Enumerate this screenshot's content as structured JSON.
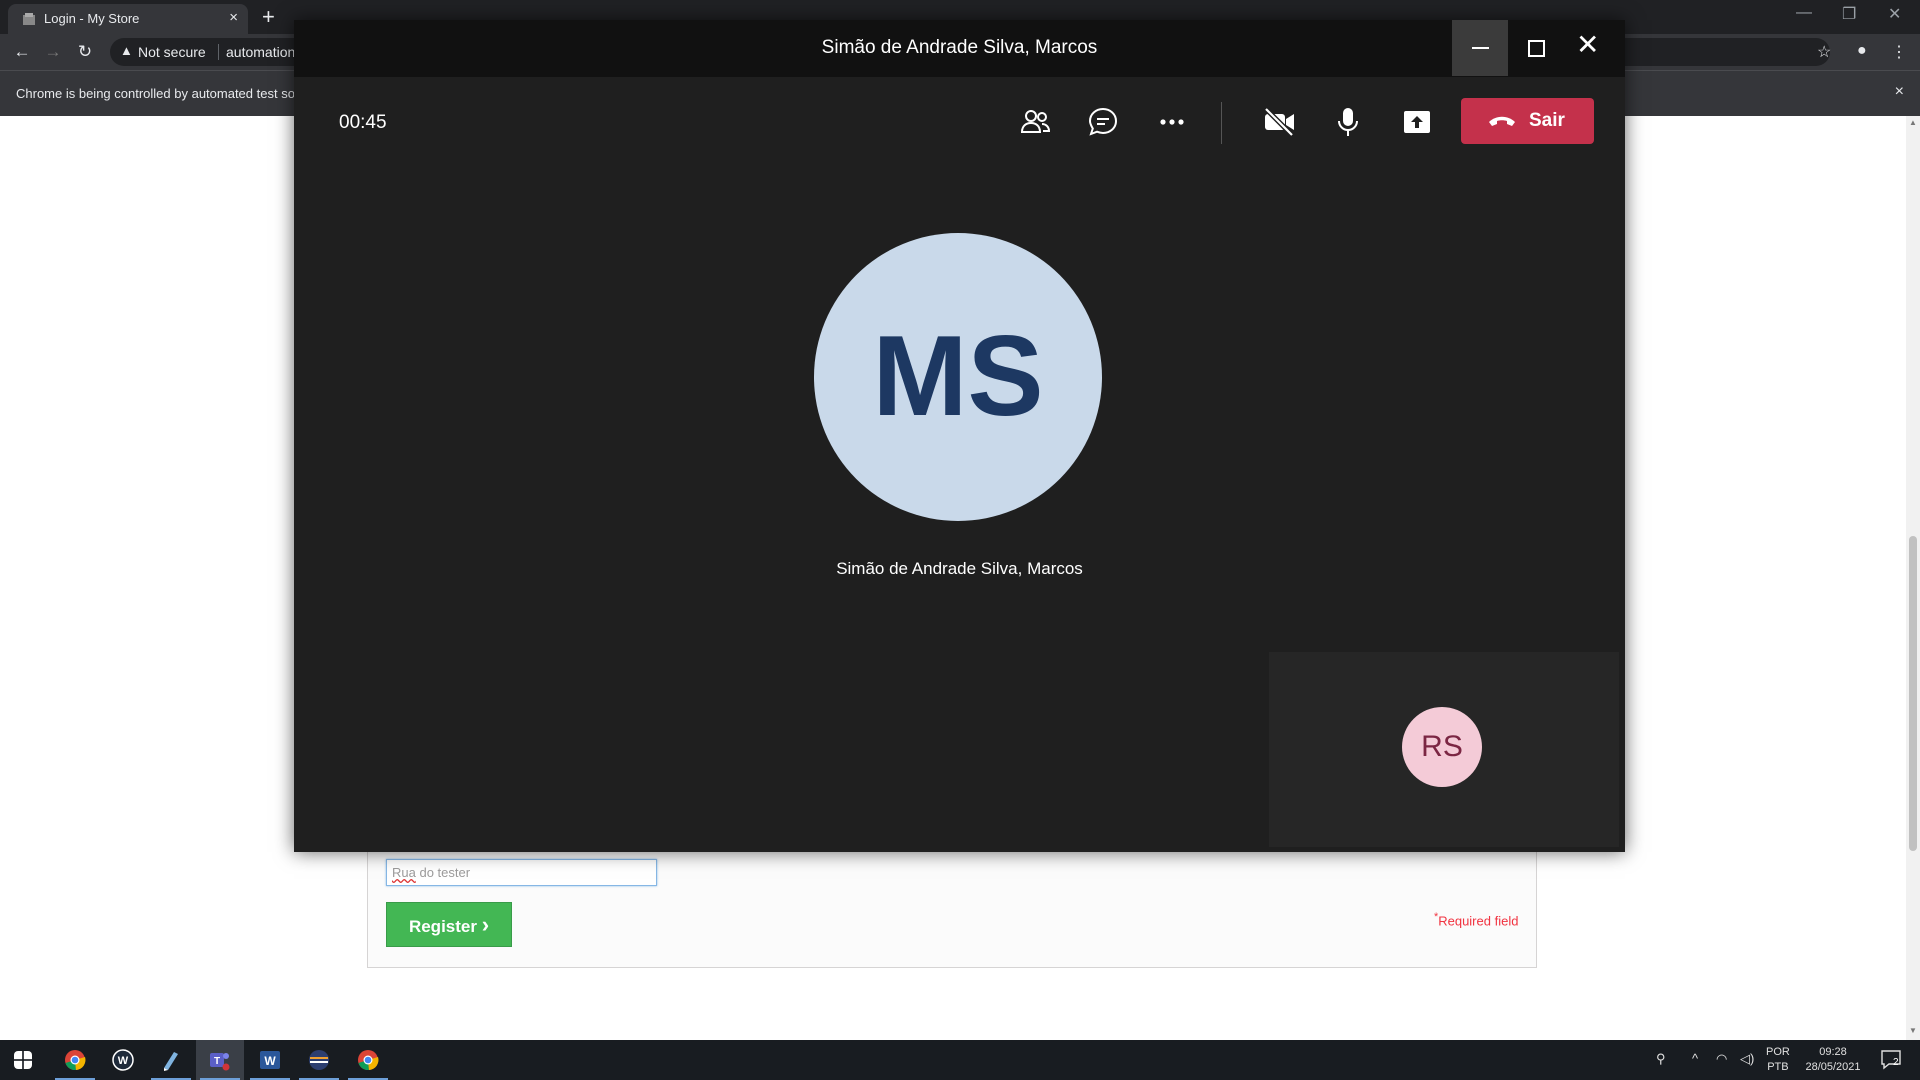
{
  "browser": {
    "tab_title": "Login - My Store",
    "tab_close": "×",
    "new_tab": "+",
    "security_label": "Not secure",
    "url": "automation",
    "infobar_text": "Chrome is being controlled by automated test so",
    "infobar_close": "×"
  },
  "page": {
    "address_value_underlined": "Rua",
    "address_value_rest": " do tester",
    "register_label": "Register",
    "register_chevron": "›",
    "required_star": "*",
    "required_text": "Required field"
  },
  "teams": {
    "window_title": "Simão de Andrade Silva, Marcos",
    "call_timer": "00:45",
    "leave_label": "Sair",
    "leave_color": "#c4314b",
    "remote_initials": "MS",
    "remote_name": "Simão de Andrade Silva, Marcos",
    "self_initials": "RS",
    "toolbar_icons": [
      "participants-icon",
      "chat-icon",
      "more-options-icon",
      "camera-off-icon",
      "microphone-icon",
      "share-screen-icon"
    ]
  },
  "taskbar": {
    "apps": [
      "start-icon",
      "chrome-icon",
      "app-w-icon",
      "app-pen-icon",
      "teams-icon",
      "word-icon",
      "app-stripe-icon",
      "chrome-icon"
    ],
    "lang_top": "POR",
    "lang_bottom": "PTB",
    "time": "09:28",
    "date": "28/05/2021",
    "notifications": "2"
  }
}
